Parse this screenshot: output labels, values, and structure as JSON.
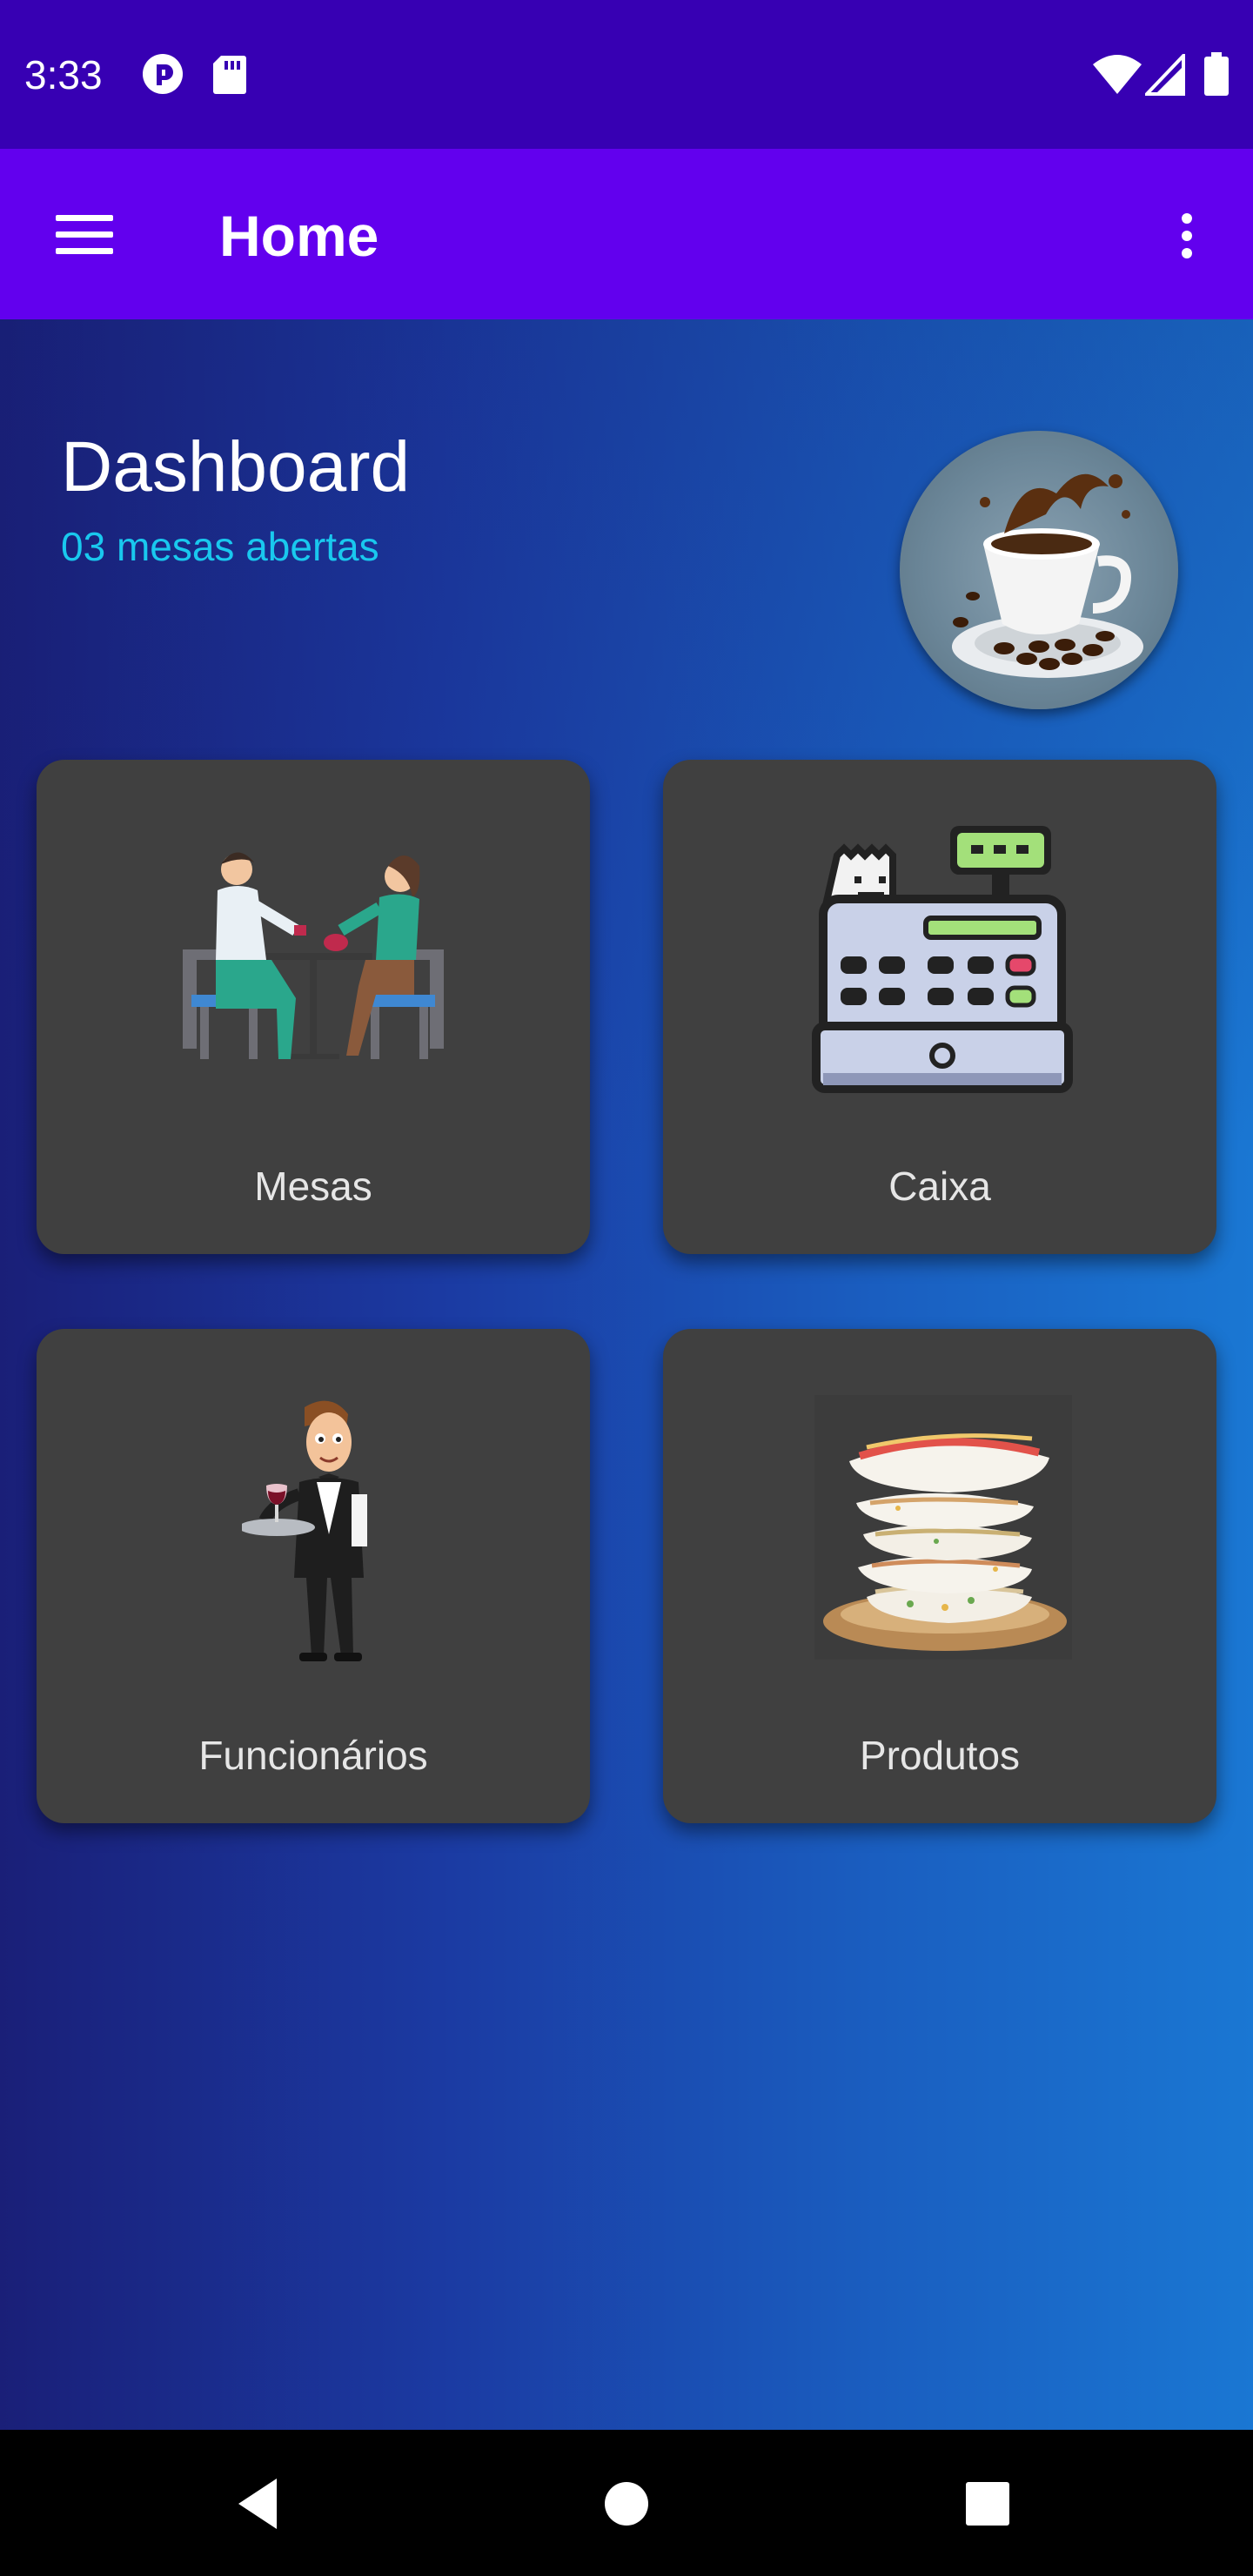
{
  "status_bar": {
    "time": "3:33",
    "icons_left": [
      "pinterest-style-notification-icon",
      "sd-card-icon"
    ],
    "icons_right": [
      "wifi-icon",
      "signal-icon",
      "battery-icon"
    ]
  },
  "app_bar": {
    "title": "Home",
    "menu_icon": "hamburger-menu-icon",
    "overflow_icon": "more-vert-icon"
  },
  "dashboard": {
    "title": "Dashboard",
    "subtitle": "03 mesas abertas"
  },
  "cards": [
    {
      "label": "Mesas",
      "icon": "restaurant-table-illustration"
    },
    {
      "label": "Caixa",
      "icon": "cash-register-illustration"
    },
    {
      "label": "Funcionários",
      "icon": "waiter-illustration"
    },
    {
      "label": "Produtos",
      "icon": "tapioca-stack-illustration"
    }
  ],
  "nav_bar": {
    "back_icon": "back-triangle-icon",
    "home_icon": "home-circle-icon",
    "recents_icon": "recents-square-icon"
  },
  "colors": {
    "status_bar": "#3700b3",
    "app_bar": "#6200ee",
    "subtitle": "#19c8ee",
    "card": "#404040"
  }
}
